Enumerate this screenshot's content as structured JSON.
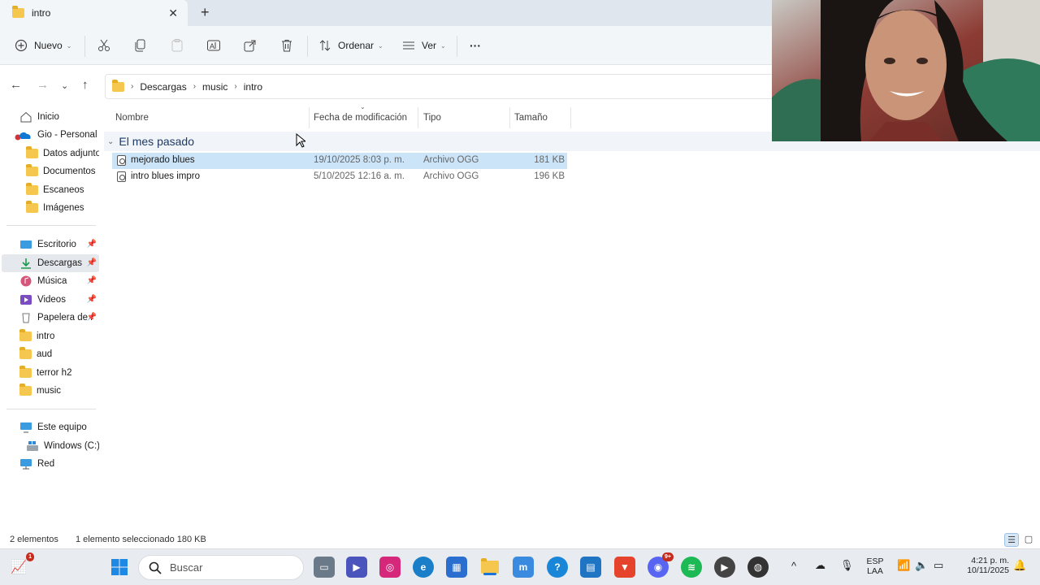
{
  "window": {
    "tab_title": "intro",
    "new_tab_symbol": "+",
    "close_symbol": "✕"
  },
  "toolbar": {
    "new_label": "Nuevo",
    "sort_label": "Ordenar",
    "view_label": "Ver",
    "more_label": "···",
    "icons": [
      "cut-icon",
      "copy-icon",
      "paste-icon",
      "rename-icon",
      "share-icon",
      "delete-icon"
    ]
  },
  "address": {
    "crumbs": [
      "Descargas",
      "music",
      "intro"
    ]
  },
  "sidebar": {
    "items": [
      {
        "label": "Inicio",
        "icon": "home-icon"
      },
      {
        "label": "Gio - Personal",
        "icon": "onedrive-icon"
      },
      {
        "label": "Datos adjunto",
        "icon": "folder-icon"
      },
      {
        "label": "Documentos",
        "icon": "folder-icon"
      },
      {
        "label": "Escaneos",
        "icon": "folder-icon"
      },
      {
        "label": "Imágenes",
        "icon": "folder-icon"
      },
      {
        "label": "Escritorio",
        "icon": "desktop-icon",
        "pinned": true
      },
      {
        "label": "Descargas",
        "icon": "download-icon",
        "pinned": true,
        "selected": true
      },
      {
        "label": "Música",
        "icon": "music-icon",
        "pinned": true
      },
      {
        "label": "Videos",
        "icon": "video-icon",
        "pinned": true
      },
      {
        "label": "Papelera de r",
        "icon": "recycle-bin-icon",
        "pinned": true
      },
      {
        "label": "intro",
        "icon": "folder-icon"
      },
      {
        "label": "aud",
        "icon": "folder-icon"
      },
      {
        "label": "terror h2",
        "icon": "folder-icon"
      },
      {
        "label": "music",
        "icon": "folder-icon"
      },
      {
        "label": "Este equipo",
        "icon": "pc-icon"
      },
      {
        "label": "Windows (C:)",
        "icon": "drive-icon"
      },
      {
        "label": "Red",
        "icon": "network-icon"
      }
    ]
  },
  "columns": {
    "name": "Nombre",
    "date": "Fecha de modificación",
    "type": "Tipo",
    "size": "Tamaño"
  },
  "group": {
    "title": "El mes pasado"
  },
  "files": [
    {
      "name": "mejorado blues",
      "date": "19/10/2025 8:03 p. m.",
      "type": "Archivo OGG",
      "size": "181 KB",
      "selected": true
    },
    {
      "name": "intro blues impro",
      "date": "5/10/2025 12:16 a. m.",
      "type": "Archivo OGG",
      "size": "196 KB",
      "selected": false
    }
  ],
  "status": {
    "count": "2 elementos",
    "selection": "1 elemento seleccionado  180 KB"
  },
  "taskbar": {
    "search_placeholder": "Buscar",
    "discord_badge": "9+",
    "widget_badge": "1",
    "lang_top": "ESP",
    "lang_bottom": "LAA",
    "time": "4:21 p. m.",
    "date": "10/11/2025"
  },
  "colors": {
    "accent": "#0078d4",
    "selection": "#cce4f7",
    "folder": "#f5c74e"
  }
}
